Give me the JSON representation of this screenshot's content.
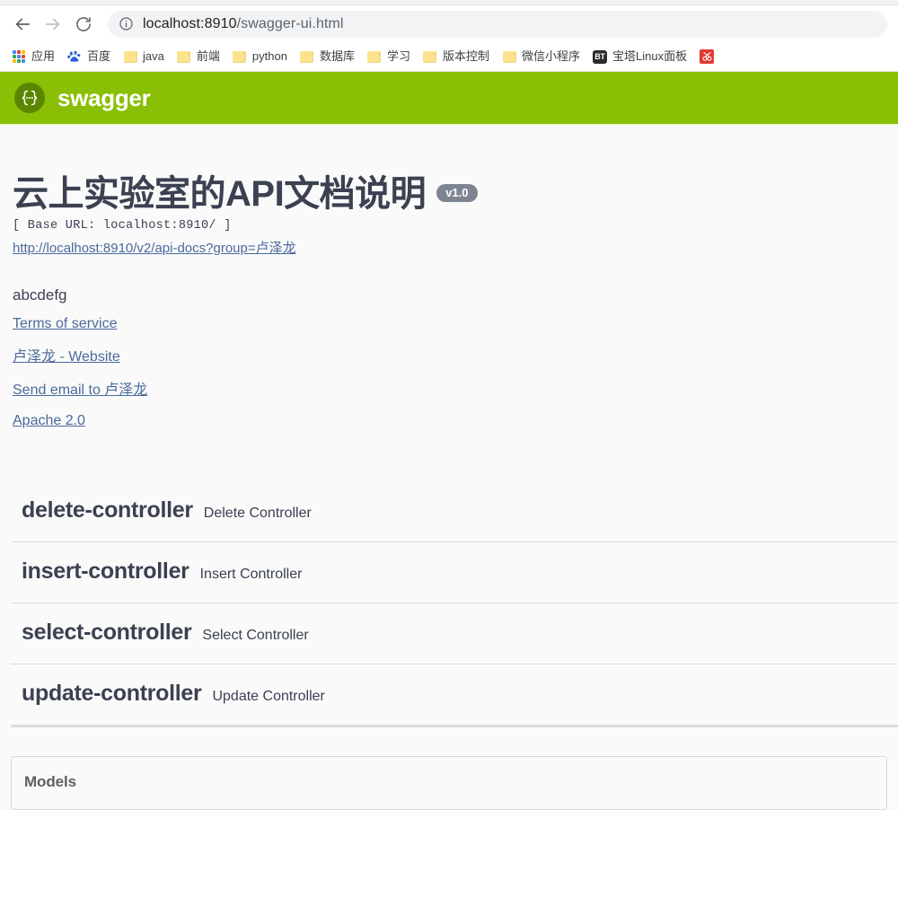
{
  "browser": {
    "nav": {
      "back_label": "Back",
      "forward_label": "Forward",
      "reload_label": "Reload"
    },
    "omnibox": {
      "host": "localhost:8910",
      "path": "/swagger-ui.html",
      "full_url": "localhost:8910/swagger-ui.html",
      "site_info_icon": "info-circle-icon"
    },
    "bookmarks": [
      {
        "label": "应用",
        "icon": "apps-grid-icon"
      },
      {
        "label": "百度",
        "icon": "baidu-paw-icon"
      },
      {
        "label": "java",
        "icon": "folder-icon"
      },
      {
        "label": "前端",
        "icon": "folder-icon"
      },
      {
        "label": "python",
        "icon": "folder-icon"
      },
      {
        "label": "数据库",
        "icon": "folder-icon"
      },
      {
        "label": "学习",
        "icon": "folder-icon"
      },
      {
        "label": "版本控制",
        "icon": "folder-icon"
      },
      {
        "label": "微信小程序",
        "icon": "folder-icon"
      },
      {
        "label": "宝塔Linux面板",
        "icon": "bt-panel-icon"
      },
      {
        "label": "",
        "icon": "red-square-icon"
      }
    ]
  },
  "topbar": {
    "wordmark": "swagger",
    "logo_icon": "swagger-braces-icon",
    "background_color": "#89bf04"
  },
  "info": {
    "title": "云上实验室的API文档说明",
    "version_badge": "v1.0",
    "base_url": "[ Base URL: localhost:8910/ ]",
    "api_docs_link": "http://localhost:8910/v2/api-docs?group=卢泽龙",
    "description": "abcdefg",
    "terms_link": "Terms of service",
    "website_link": "卢泽龙 - Website",
    "email_link": "Send email to 卢泽龙",
    "license_link": "Apache 2.0"
  },
  "tags": [
    {
      "name": "delete-controller",
      "description": "Delete Controller"
    },
    {
      "name": "insert-controller",
      "description": "Insert Controller"
    },
    {
      "name": "select-controller",
      "description": "Select Controller"
    },
    {
      "name": "update-controller",
      "description": "Update Controller"
    }
  ],
  "models": {
    "title": "Models"
  }
}
